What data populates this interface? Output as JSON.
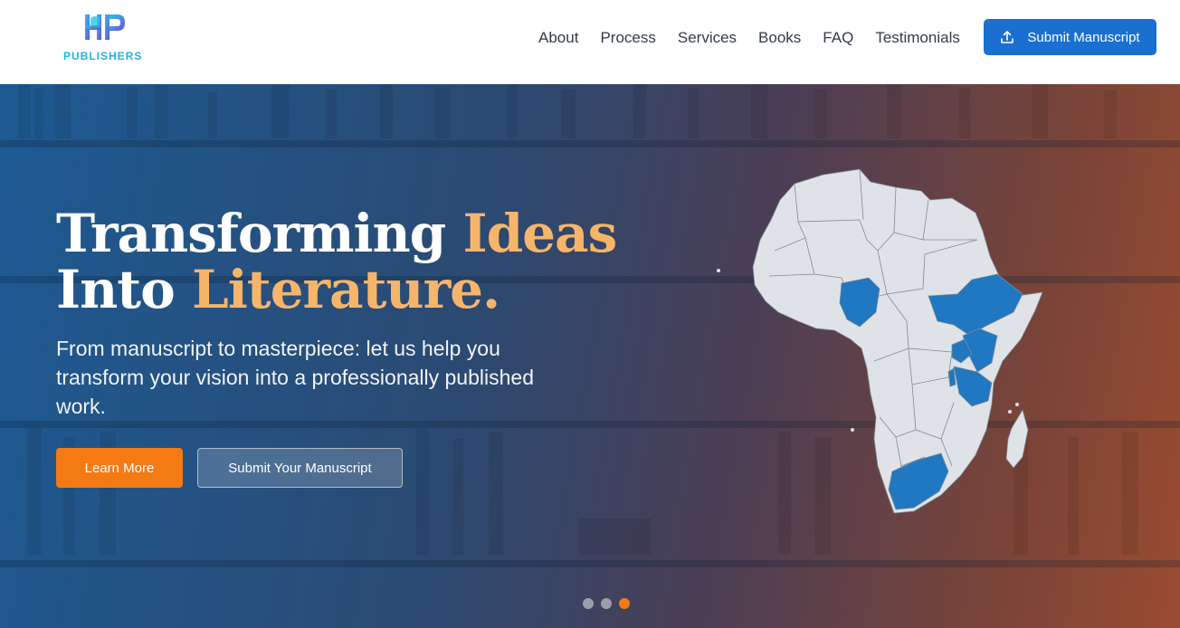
{
  "brand": {
    "logo_letters": "HP",
    "name": "PUBLISHERS",
    "color": "#1fb6e0"
  },
  "nav": {
    "items": [
      {
        "label": "About"
      },
      {
        "label": "Process"
      },
      {
        "label": "Services"
      },
      {
        "label": "Books"
      },
      {
        "label": "FAQ"
      },
      {
        "label": "Testimonials"
      }
    ],
    "cta_label": "Submit Manuscript",
    "cta_icon": "upload-icon"
  },
  "hero": {
    "title_part1": "Transforming",
    "title_accent1": "Ideas",
    "title_part2": "Into",
    "title_accent2": "Literature.",
    "subtitle": "From manuscript to masterpiece: let us help you transform your vision into a professionally published work.",
    "primary_button": "Learn More",
    "secondary_button": "Submit Your Manuscript",
    "accent_color": "#f7b56a",
    "map": "africa-map",
    "highlight_color": "#1f78c1",
    "carousel": {
      "slides": 3,
      "active": 3
    }
  }
}
